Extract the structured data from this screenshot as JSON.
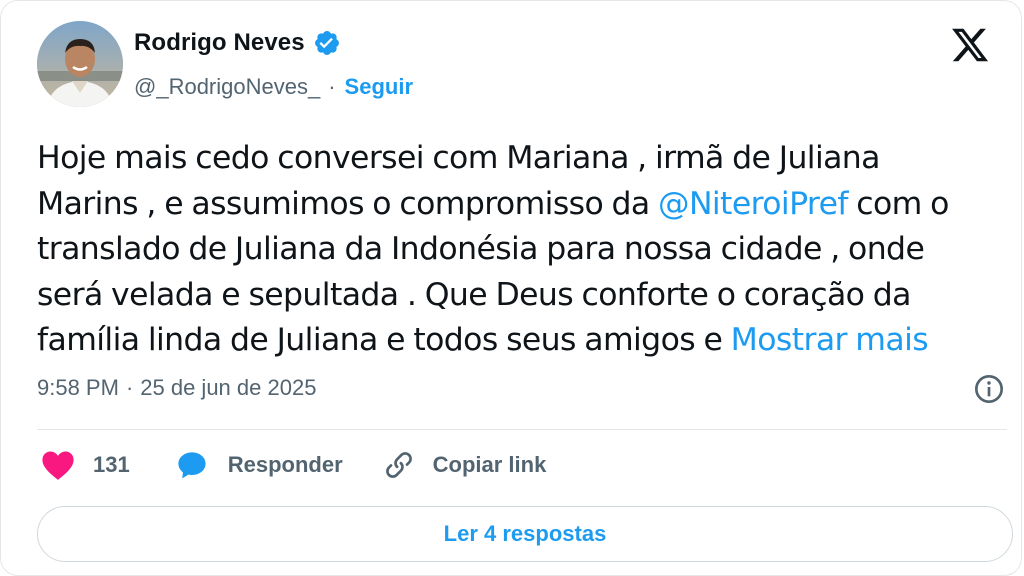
{
  "author": {
    "name": "Rodrigo Neves",
    "handle": "@_RodrigoNeves_",
    "follow_label": "Seguir",
    "verified": true
  },
  "tweet": {
    "line1": "Hoje mais cedo conversei com Mariana , irmã de Juliana",
    "line2_before": "Marins , e assumimos o compromisso da ",
    "line2_mention": "@NiteroiPref",
    "line2_after": " com o",
    "line3": "translado de Juliana da Indonésia para nossa cidade , onde",
    "line4": "será velada e sepultada . Que Deus conforte o coração da",
    "line5_before": "família linda de Juliana e todos seus amigos e ",
    "show_more": "Mostrar mais"
  },
  "meta": {
    "time": "9:58 PM",
    "separator": "·",
    "date": "25 de jun de 2025"
  },
  "actions": {
    "likes": "131",
    "reply_label": "Responder",
    "copy_label": "Copiar link"
  },
  "read_replies_label": "Ler 4 respostas",
  "colors": {
    "accent": "#1d9bf0",
    "like": "#f91880",
    "text": "#0f1419",
    "muted": "#536471"
  },
  "icons": [
    "verified-badge-icon",
    "x-logo-icon",
    "info-icon",
    "heart-icon",
    "reply-bubble-icon",
    "link-icon"
  ]
}
